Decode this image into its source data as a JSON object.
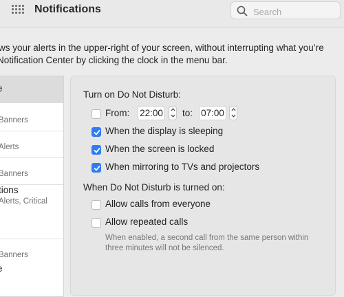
{
  "titlebar": {
    "title": "Notifications",
    "search_placeholder": "Search"
  },
  "description": {
    "line1": "ws your alerts in the upper-right of your screen, without interrupting what you’re",
    "line2": "Notification Center by clicking the clock in the menu bar."
  },
  "sidebar": {
    "items": [
      {
        "label": "e",
        "sub": ""
      },
      {
        "label": "",
        "sub": "Banners"
      },
      {
        "label": "",
        "sub": "Alerts"
      },
      {
        "label": "",
        "sub": "Banners"
      },
      {
        "label": "tions",
        "sub": "Alerts, Critical"
      },
      {
        "label": "",
        "sub": "Banners"
      },
      {
        "label": "e",
        "sub": ""
      }
    ]
  },
  "dnd": {
    "heading": "Turn on Do Not Disturb:",
    "from_label": "From:",
    "from_time": "22:00",
    "to_label": "to:",
    "to_time": "07:00",
    "from_checked": false,
    "options": [
      {
        "label": "When the display is sleeping",
        "checked": true
      },
      {
        "label": "When the screen is locked",
        "checked": true
      },
      {
        "label": "When mirroring to TVs and projectors",
        "checked": true
      }
    ],
    "when_on_heading": "When Do Not Disturb is turned on:",
    "calls_from_everyone": {
      "label": "Allow calls from everyone",
      "checked": false
    },
    "repeated_calls": {
      "label": "Allow repeated calls",
      "checked": false
    },
    "note_line1": "When enabled, a second call from the same person within",
    "note_line2": "three minutes will not be silenced."
  },
  "colors": {
    "accent": "#2f7cf6",
    "panel_bg": "#e6e6e6",
    "window_bg": "#ececec"
  }
}
